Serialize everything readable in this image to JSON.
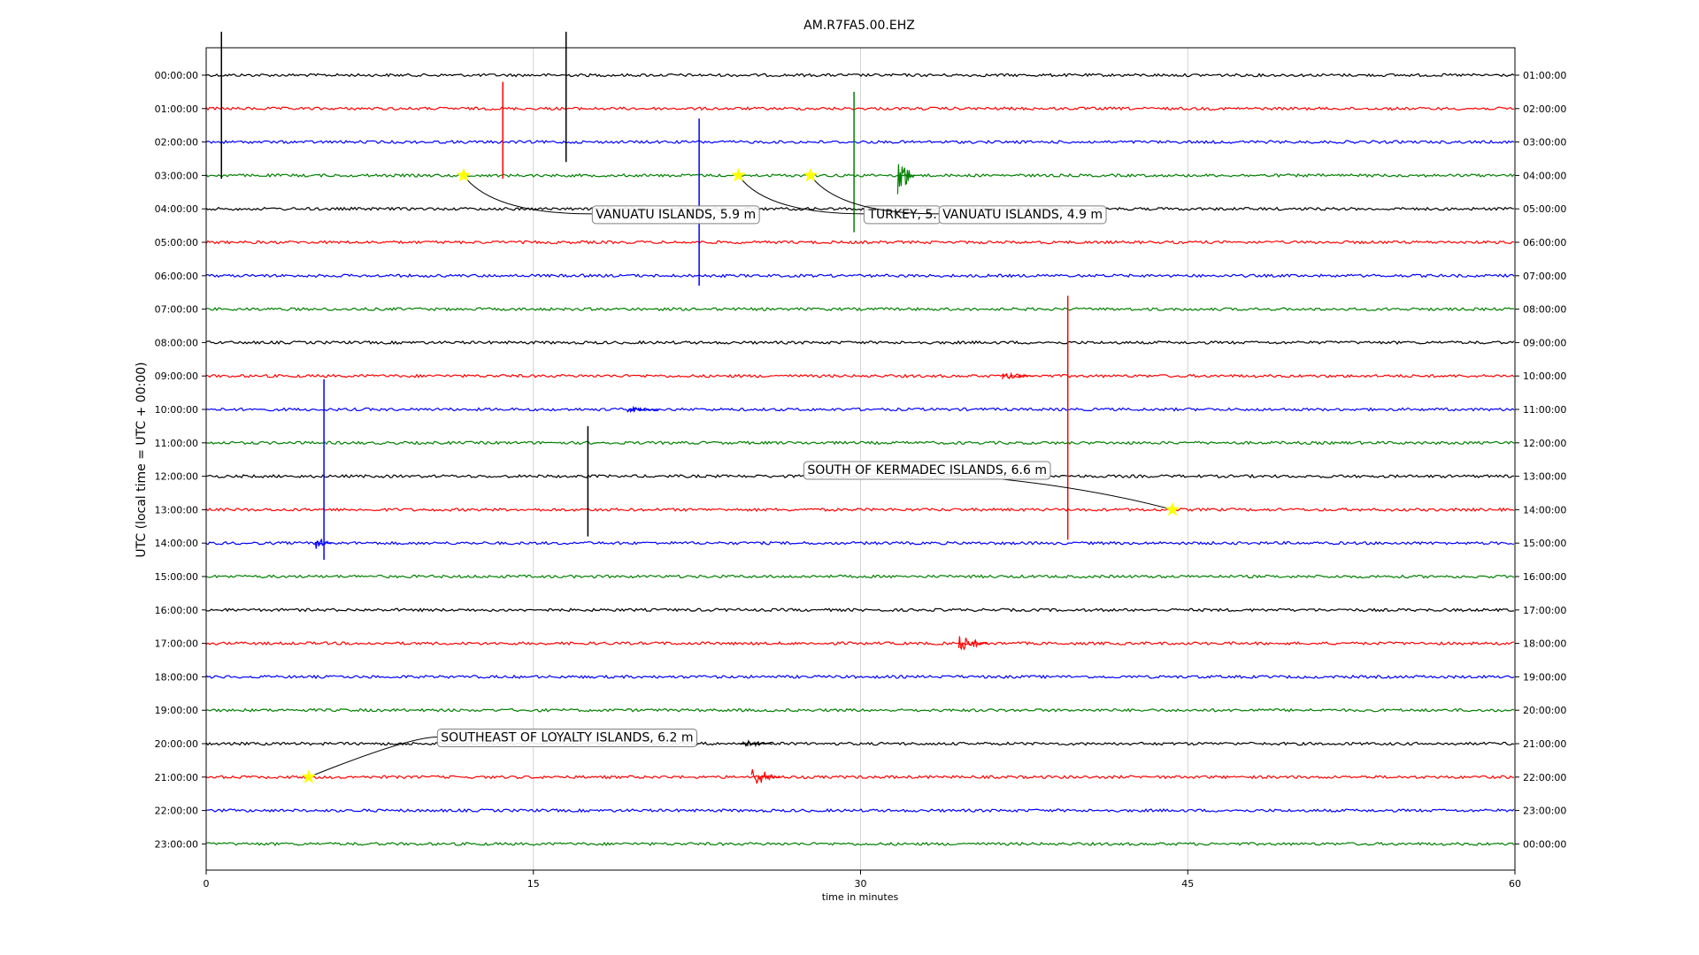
{
  "chart_data": {
    "type": "line",
    "title": "AM.R7FA5.00.EHZ",
    "xlabel": "time in minutes",
    "ylabel": "UTC (local time = UTC + 00:00)",
    "xlim": [
      0,
      60
    ],
    "x_ticks": [
      "0",
      "15",
      "30",
      "45",
      "60"
    ],
    "grid": "vertical",
    "colors": [
      "#000000",
      "#ff0000",
      "#0000ff",
      "#008000"
    ],
    "star_color": "#ffff00",
    "left_tick_labels": [
      "00:00:00",
      "01:00:00",
      "02:00:00",
      "03:00:00",
      "04:00:00",
      "05:00:00",
      "06:00:00",
      "07:00:00",
      "08:00:00",
      "09:00:00",
      "10:00:00",
      "11:00:00",
      "12:00:00",
      "13:00:00",
      "14:00:00",
      "15:00:00",
      "16:00:00",
      "17:00:00",
      "18:00:00",
      "19:00:00",
      "20:00:00",
      "21:00:00",
      "22:00:00",
      "23:00:00"
    ],
    "right_tick_labels": [
      "01:00:00",
      "02:00:00",
      "03:00:00",
      "04:00:00",
      "05:00:00",
      "06:00:00",
      "07:00:00",
      "08:00:00",
      "09:00:00",
      "10:00:00",
      "11:00:00",
      "12:00:00",
      "13:00:00",
      "14:00:00",
      "15:00:00",
      "16:00:00",
      "17:00:00",
      "18:00:00",
      "19:00:00",
      "20:00:00",
      "21:00:00",
      "22:00:00",
      "23:00:00",
      "00:00:00"
    ],
    "spikes": [
      {
        "row": 0,
        "t": 0.7,
        "up": 1.3,
        "down": 3.1
      },
      {
        "row": 1,
        "t": 13.6,
        "up": 0.8,
        "down": 2.1
      },
      {
        "row": 0,
        "t": 16.5,
        "up": 1.3,
        "down": 2.6
      },
      {
        "row": 2,
        "t": 22.6,
        "up": 0.7,
        "down": 4.3
      },
      {
        "row": 3,
        "t": 29.7,
        "up": 2.5,
        "down": 1.7
      },
      {
        "row": 9,
        "t": 39.5,
        "up": 2.4,
        "down": 4.9
      },
      {
        "row": 10,
        "t": 5.4,
        "up": 0.9,
        "down": 4.5
      },
      {
        "row": 12,
        "t": 17.5,
        "up": 1.5,
        "down": 1.8
      }
    ],
    "bursts": [
      {
        "row": 3,
        "t": 31.7,
        "dur": 0.8,
        "amp": 0.6
      },
      {
        "row": 14,
        "t": 5.0,
        "dur": 0.8,
        "amp": 0.2
      },
      {
        "row": 17,
        "t": 34.5,
        "dur": 1.3,
        "amp": 0.25
      },
      {
        "row": 21,
        "t": 25.0,
        "dur": 1.3,
        "amp": 0.3
      },
      {
        "row": 20,
        "t": 24.5,
        "dur": 1.5,
        "amp": 0.12
      },
      {
        "row": 10,
        "t": 19.3,
        "dur": 1.5,
        "amp": 0.08
      },
      {
        "row": 9,
        "t": 36.5,
        "dur": 1.5,
        "amp": 0.1
      }
    ],
    "events": [
      {
        "label": "VANUATU ISLANDS, 5.9 m",
        "row": 3,
        "t": 11.8,
        "label_row": 4.15,
        "label_t": 17.7
      },
      {
        "label": "TURKEY, 5.",
        "row": 3,
        "t": 24.4,
        "label_row": 4.15,
        "label_t": 30.2
      },
      {
        "label": "VANUATU ISLANDS, 4.9 m",
        "row": 3,
        "t": 27.7,
        "label_row": 4.15,
        "label_t": 33.6
      },
      {
        "label": "SOUTH OF KERMADEC ISLANDS, 6.6 m",
        "row": 13,
        "t": 44.3,
        "label_row": 11.8,
        "label_t": 27.4
      },
      {
        "label": "SOUTHEAST OF LOYALTY ISLANDS, 6.2 m",
        "row": 21,
        "t": 4.7,
        "label_row": 19.8,
        "label_t": 10.6
      }
    ]
  }
}
